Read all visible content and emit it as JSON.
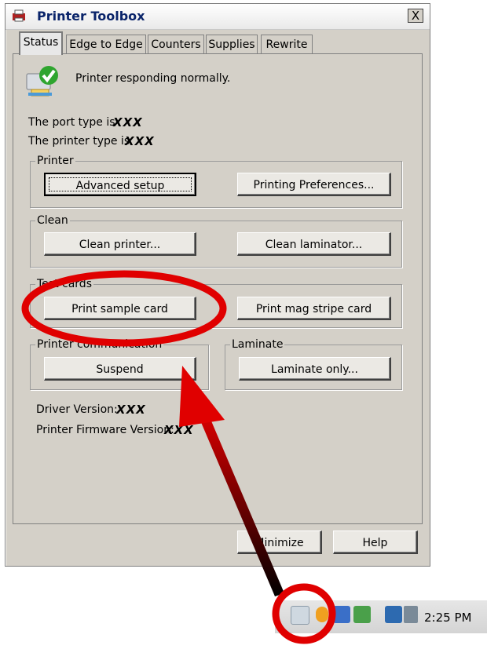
{
  "window": {
    "title": "Printer Toolbox",
    "close_label": "X"
  },
  "tabs": [
    {
      "label": "Status"
    },
    {
      "label": "Edge to Edge"
    },
    {
      "label": "Counters"
    },
    {
      "label": "Supplies"
    },
    {
      "label": "Rewrite"
    }
  ],
  "status": {
    "message": "Printer responding normally.",
    "port_prefix": "The port type is",
    "port_value": "XXX",
    "printer_prefix": "The printer type is",
    "printer_value": "XXX"
  },
  "groups": {
    "printer": {
      "label": "Printer",
      "advanced": "Advanced setup",
      "preferences": "Printing Preferences..."
    },
    "clean": {
      "label": "Clean",
      "clean_printer": "Clean printer...",
      "clean_laminator": "Clean laminator..."
    },
    "test_cards": {
      "label": "Test cards",
      "sample": "Print sample card",
      "mag": "Print mag stripe card"
    },
    "communication": {
      "label": "Printer communication",
      "suspend": "Suspend"
    },
    "laminate": {
      "label": "Laminate",
      "laminate_only": "Laminate only..."
    }
  },
  "versions": {
    "driver_prefix": "Driver Version:",
    "driver_value": "XXX",
    "firmware_prefix": "Printer Firmware Version:",
    "firmware_value": "XXX"
  },
  "footer": {
    "minimize": "Minimize",
    "help": "Help"
  },
  "taskbar": {
    "clock": "2:25 PM"
  },
  "colors": {
    "highlight_red": "#e00000",
    "title_blue": "#0a246a"
  }
}
